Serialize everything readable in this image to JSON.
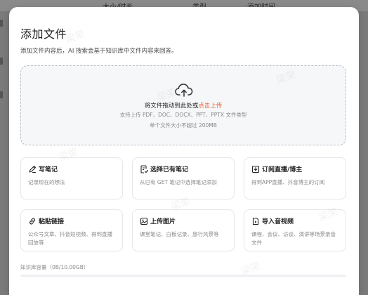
{
  "background": {
    "columns": [
      "大小/时长",
      "类型",
      "添加时间"
    ]
  },
  "modal": {
    "title": "添加文件",
    "subtitle": "添加文件内容后，AI 搜索会基于知识库中文件内容来回答。",
    "dropzone": {
      "main_text": "将文件拖动到此处或",
      "link_text": "点击上传",
      "supported": "支持上传 PDF、DOC、DOCX、PPT、PPTX 文件类型",
      "size_limit": "单个文件大小不超过 200MB"
    },
    "cards": [
      {
        "title": "写笔记",
        "desc": "记录现在的想法",
        "icon": "pen-icon"
      },
      {
        "title": "选择已有笔记",
        "desc": "从已有 GET 笔记中选择笔记添加",
        "icon": "note-select-icon"
      },
      {
        "title": "订阅直播/博主",
        "desc": "得到APP直播、抖音博主的订阅",
        "icon": "subscribe-icon"
      },
      {
        "title": "粘贴链接",
        "desc": "公众号文章、抖音短视频、得到直播回放等",
        "icon": "link-icon"
      },
      {
        "title": "上传图片",
        "desc": "课堂笔记、白板记录、旅行风景等",
        "icon": "image-icon"
      },
      {
        "title": "导入音视频",
        "desc": "课程、会议、访谈、演讲等场景录音文件",
        "icon": "audio-video-icon"
      }
    ],
    "capacity": {
      "label": "知识库容量（0B/10.00GB）",
      "used_fraction": 0
    },
    "watermark": "梁荣"
  },
  "colors": {
    "accent": "#e8622e",
    "progress": "#3b82f6"
  }
}
